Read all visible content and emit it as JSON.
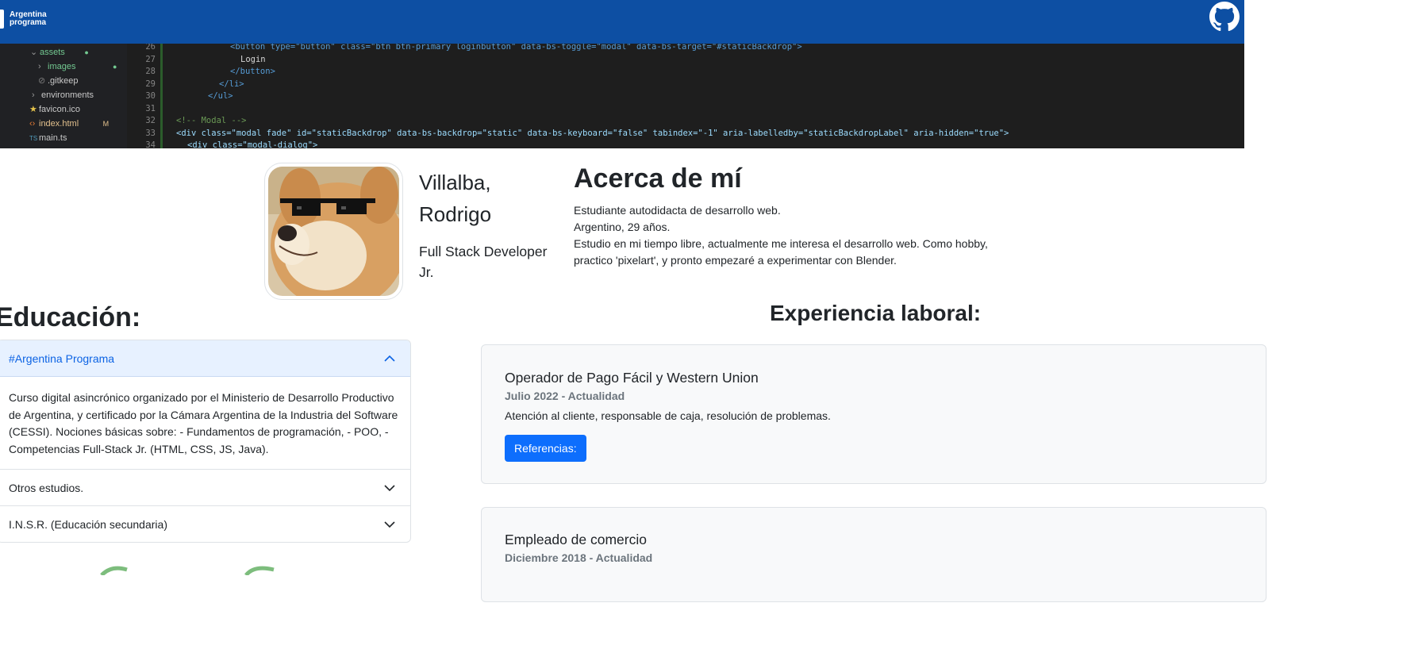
{
  "navbar": {
    "brand_line1": "Argentina",
    "brand_line2": "programa",
    "github_icon": "github-icon",
    "bg_color": "#0d4fa3"
  },
  "code_banner": {
    "explorer": [
      {
        "label": "assets",
        "arrow": "⌄",
        "git": "●"
      },
      {
        "label": "images",
        "arrow": "›",
        "git": "●"
      },
      {
        "label": ".gitkeep",
        "arrow": "",
        "git": ""
      },
      {
        "label": "environments",
        "arrow": "›",
        "git": ""
      },
      {
        "label": "favicon.ico",
        "arrow": "",
        "git": ""
      },
      {
        "label": "index.html",
        "arrow": "",
        "git": "M"
      },
      {
        "label": "main.ts",
        "arrow": "",
        "git": ""
      }
    ],
    "line_numbers": [
      "26",
      "27",
      "28",
      "29",
      "30",
      "31",
      "32",
      "33",
      "34"
    ],
    "lines": [
      "<button type=\"button\" class=\"btn btn-primary loginbutton\" data-bs-toggle=\"modal\" data-bs-target=\"#staticBackdrop\">",
      "Login",
      "</button>",
      "</li>",
      "</ul>",
      "",
      "<!-- Modal -->",
      "<div class=\"modal fade\" id=\"staticBackdrop\" data-bs-backdrop=\"static\" data-bs-keyboard=\"false\" tabindex=\"-1\" aria-labelledby=\"staticBackdropLabel\" aria-hidden=\"true\">",
      "<div class=\"modal-dialog\">"
    ]
  },
  "profile": {
    "name_line1": "Villalba,",
    "name_line2": "Rodrigo",
    "role": "Full Stack Developer Jr."
  },
  "about": {
    "title": "Acerca de mí",
    "line1": "Estudiante autodidacta de desarrollo web.",
    "line2": "Argentino, 29 años.",
    "line3": "Estudio en mi tiempo libre, actualmente me interesa el desarrollo web. Como hobby, practico 'pixelart', y pronto empezaré a experimentar con Blender."
  },
  "education": {
    "title": "Educación:",
    "items": [
      {
        "label": "#Argentina Programa",
        "expanded": true,
        "body": "Curso digital asincrónico organizado por el Ministerio de Desarrollo Productivo de Argentina, y certificado por la Cámara Argentina de la Industria del Software (CESSI). Nociones básicas sobre: - Fundamentos de programación, - POO, - Competencias Full-Stack Jr. (HTML, CSS, JS, Java)."
      },
      {
        "label": "Otros estudios.",
        "expanded": false
      },
      {
        "label": "I.N.S.R. (Educación secundaria)",
        "expanded": false
      }
    ]
  },
  "experience": {
    "title": "Experiencia laboral:",
    "cards": [
      {
        "title": "Operador de Pago Fácil y Western Union",
        "dates": "Julio 2022 - Actualidad",
        "text": "Atención al cliente, responsable de caja, resolución de problemas.",
        "button": "Referencias:"
      },
      {
        "title": "Empleado de comercio",
        "dates": "Diciembre 2018 - Actualidad"
      }
    ]
  },
  "colors": {
    "primary": "#0d6efd",
    "accordion_active_bg": "#e7f1ff",
    "accordion_active_text": "#0c63e4",
    "muted": "#6c757d",
    "card_bg": "#f8f9fa"
  }
}
